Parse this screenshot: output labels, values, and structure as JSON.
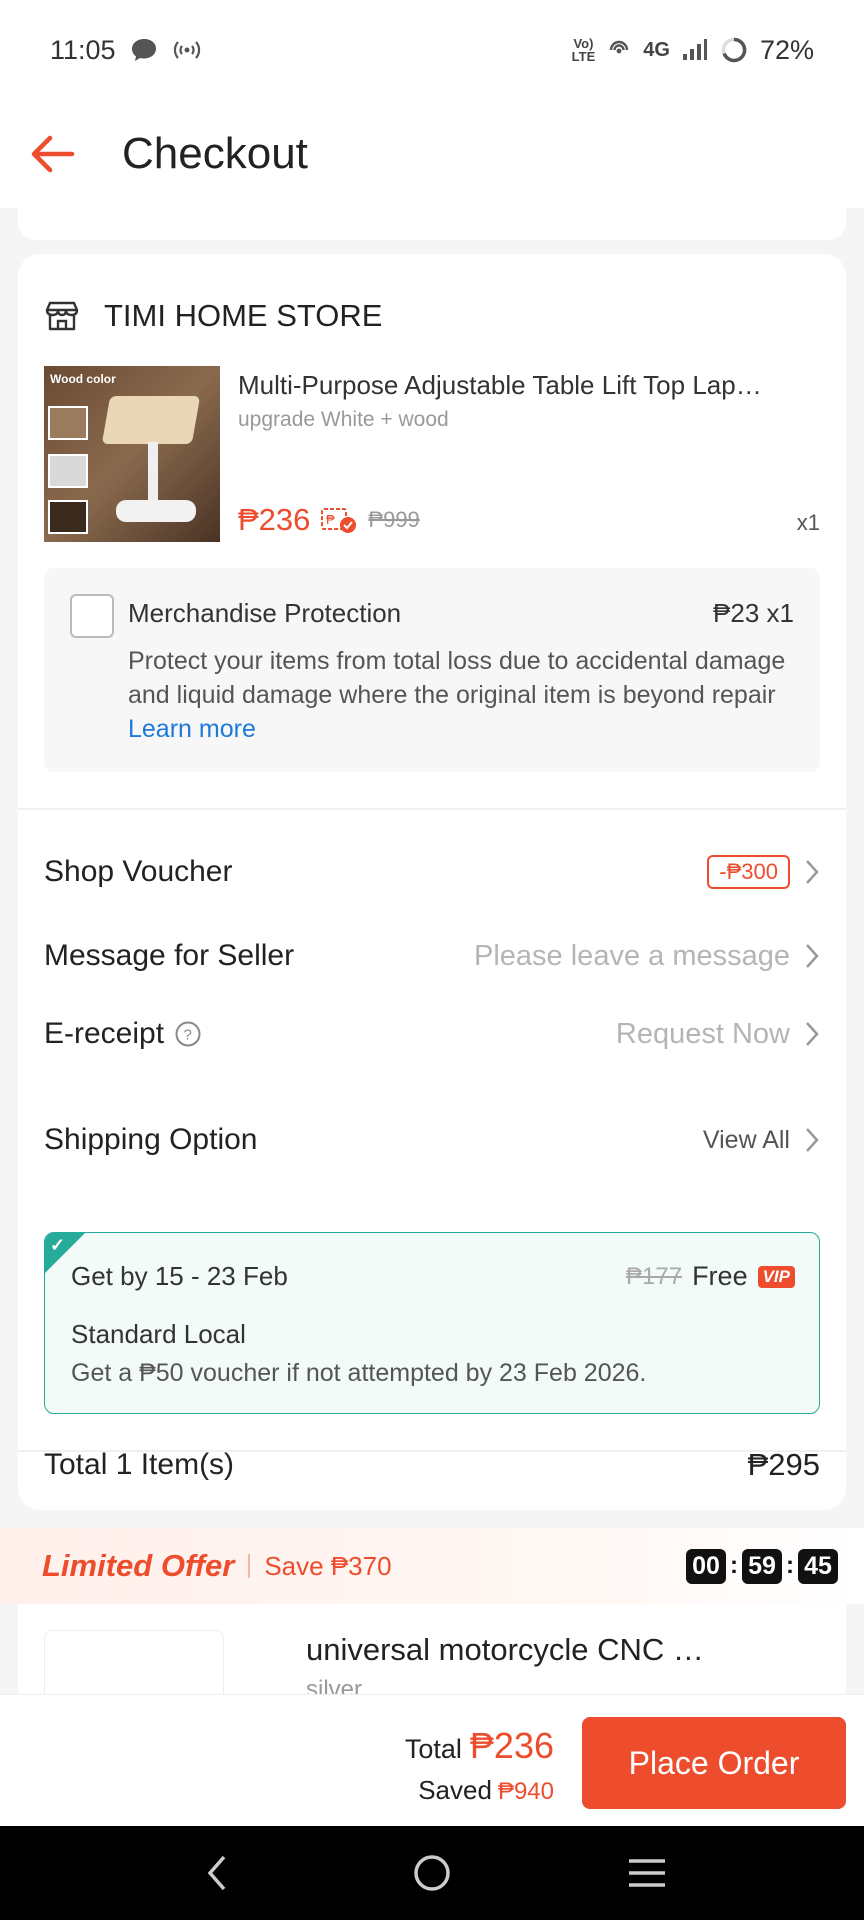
{
  "status_bar": {
    "time": "11:05",
    "network_label": "4G",
    "volte_label": "Vo)\nLTE",
    "battery": "72%"
  },
  "header": {
    "title": "Checkout",
    "back_icon": "arrow-left-icon"
  },
  "shop": {
    "name": "TIMI HOME STORE",
    "icon": "store-icon",
    "product": {
      "image_label": "Wood color",
      "title": "Multi-Purpose Adjustable Table Lift Top Lap…",
      "variant": "upgrade White + wood",
      "price": "₱236",
      "original_price": "₱999",
      "quantity": "x1"
    },
    "protection": {
      "title": "Merchandise Protection",
      "price": "₱23  x1",
      "description": "Protect your items from total loss due to accidental damage and liquid damage where the original item is beyond repair",
      "link": "Learn more"
    },
    "shop_voucher": {
      "label": "Shop Voucher",
      "value": "-₱300"
    },
    "message_for_seller": {
      "label": "Message for Seller",
      "placeholder": "Please leave a message"
    },
    "e_receipt": {
      "label": "E-receipt",
      "value": "Request Now"
    },
    "shipping": {
      "label": "Shipping Option",
      "view_all": "View All",
      "delivery_date": "Get by 15 - 23 Feb",
      "original_fee": "₱177",
      "fee": "Free",
      "vip_badge": "VIP",
      "method": "Standard Local",
      "note": "Get a ₱50 voucher if not attempted by 23 Feb 2026."
    },
    "total": {
      "label": "Total 1 Item(s)",
      "value": "₱295"
    }
  },
  "limited_offer": {
    "title": "Limited Offer",
    "save": "Save ₱370",
    "countdown": [
      "00",
      "59",
      "45"
    ],
    "item_title": "universal motorcycle CNC …",
    "item_variant": "silver"
  },
  "footer": {
    "total_label": "Total",
    "total_value": "₱236",
    "saved_label": "Saved",
    "saved_value": "₱940",
    "place_order": "Place Order"
  },
  "colors": {
    "accent": "#ee4d2d",
    "shipping_green": "#26aa99",
    "link_blue": "#1e7ad8"
  }
}
